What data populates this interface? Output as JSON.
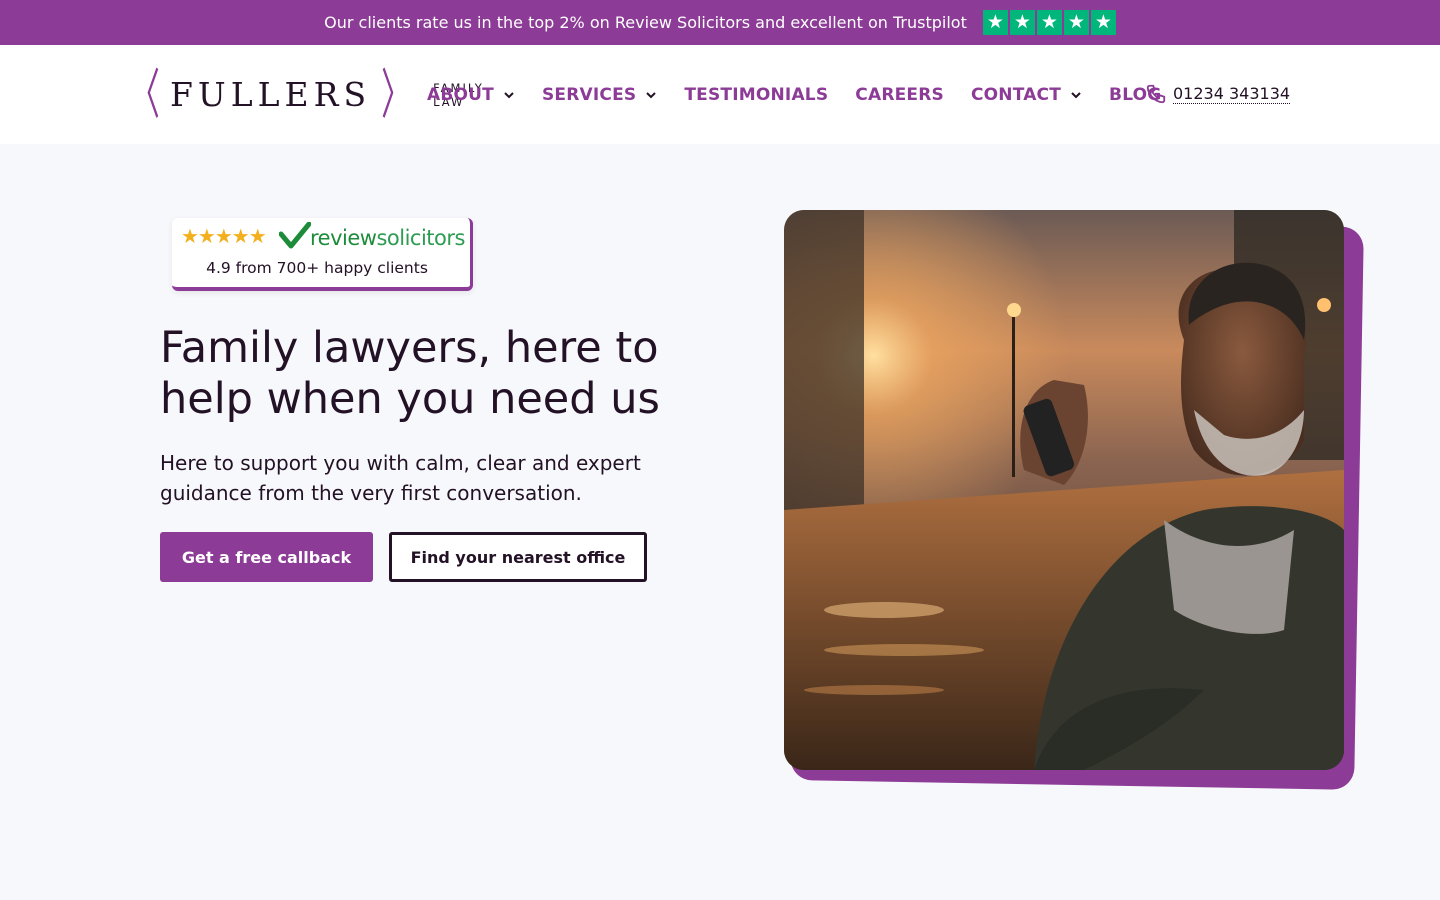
{
  "topbar": {
    "text": "Our clients rate us in the top 2% on Review Solicitors and excellent on Trustpilot",
    "trustpilot_stars": 5,
    "star_glyph": "★"
  },
  "header": {
    "logo": {
      "name": "FULLERS",
      "sub_line1": "FAMILY",
      "sub_line2": "LAW"
    },
    "nav": [
      {
        "label": "ABOUT",
        "dropdown": true
      },
      {
        "label": "SERVICES",
        "dropdown": true
      },
      {
        "label": "TESTIMONIALS",
        "dropdown": false
      },
      {
        "label": "CAREERS",
        "dropdown": false
      },
      {
        "label": "CONTACT",
        "dropdown": true
      },
      {
        "label": "BLOG",
        "dropdown": false
      }
    ],
    "phone": "01234 343134"
  },
  "review_badge": {
    "stars": "★★★★★",
    "brand_review": "review",
    "brand_solicitors": "solicitors",
    "rating_text": "4.9 from 700+ happy clients"
  },
  "hero": {
    "title": "Family lawyers, here to help when you need us",
    "subtitle": "Here to support you with calm, clear and expert guidance from the very first conversation.",
    "primary_button": "Get a free callback",
    "secondary_button": "Find your nearest office"
  },
  "colors": {
    "brand_purple": "#8c3b96",
    "text_dark": "#231126",
    "trustpilot_green": "#00b67a",
    "star_gold": "#f2b01e"
  }
}
